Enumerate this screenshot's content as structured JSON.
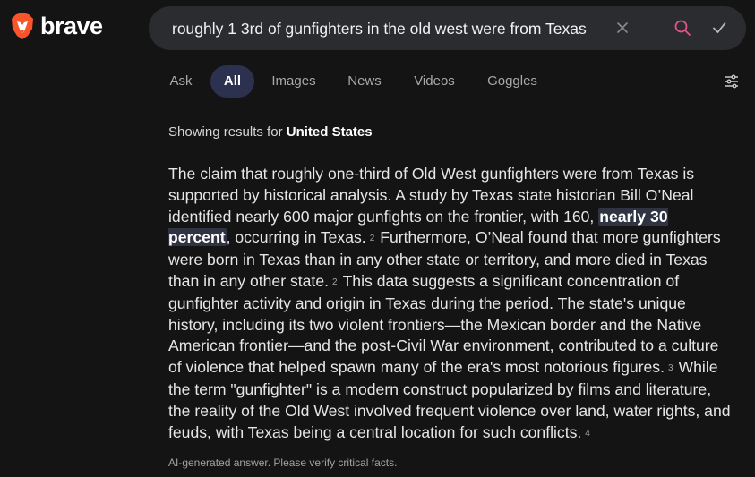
{
  "brand": {
    "name": "brave",
    "logo_icon": "brave-lion-icon",
    "logo_color": "#fb542b"
  },
  "search": {
    "query": "roughly 1 3rd of gunfighters in the old west were from Texas",
    "placeholder": ""
  },
  "tabs": [
    {
      "label": "Ask",
      "active": false
    },
    {
      "label": "All",
      "active": true
    },
    {
      "label": "Images",
      "active": false
    },
    {
      "label": "News",
      "active": false
    },
    {
      "label": "Videos",
      "active": false
    },
    {
      "label": "Goggles",
      "active": false
    }
  ],
  "region": {
    "prefix": "Showing results for",
    "name": "United States"
  },
  "answer": {
    "seg1": "The claim that roughly one-third of Old West gunfighters were from Texas is supported by historical analysis. A study by Texas state historian Bill O’Neal identified nearly 600 major gunfights on the frontier, with 160, ",
    "highlight": "nearly 30 percent",
    "seg2": ", occurring in Texas.",
    "cite1": "2",
    "seg3": "Furthermore, O’Neal found that more gunfighters were born in Texas than in any other state or territory, and more died in Texas than in any other state.",
    "cite2": "2",
    "seg4": "This data suggests a significant concentration of gunfighter activity and origin in Texas during the period. The state's unique history, including its two violent frontiers—the Mexican border and the Native American frontier—and the post-Civil War environment, contributed to a culture of violence that helped spawn many of the era's most notorious figures.",
    "cite3": "3",
    "seg5": "While the term \"gunfighter\" is a modern construct popularized by films and literature, the reality of the Old West involved frequent violence over land, water rights, and feuds, with Texas being a central location for such conflicts.",
    "cite4": "4"
  },
  "disclaimer": "AI-generated answer. Please verify critical facts."
}
